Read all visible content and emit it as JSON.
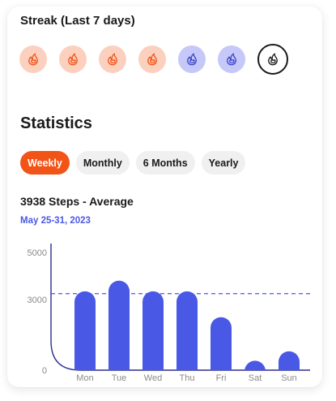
{
  "streak": {
    "title": "Streak (Last 7 days)",
    "days": [
      {
        "state": "done",
        "color": "#f25418",
        "icon": "fire-icon"
      },
      {
        "state": "done",
        "color": "#f25418",
        "icon": "fire-icon"
      },
      {
        "state": "done",
        "color": "#f25418",
        "icon": "fire-icon"
      },
      {
        "state": "done",
        "color": "#f25418",
        "icon": "fire-icon"
      },
      {
        "state": "partial",
        "color": "#3b46c9",
        "icon": "fire-icon"
      },
      {
        "state": "partial",
        "color": "#3b46c9",
        "icon": "fire-icon"
      },
      {
        "state": "today",
        "color": "#1a1a1a",
        "icon": "fire-icon"
      }
    ]
  },
  "statistics": {
    "title": "Statistics",
    "tabs": [
      "Weekly",
      "Monthly",
      "6 Months",
      "Yearly"
    ],
    "active_tab": "Weekly"
  },
  "summary": {
    "headline": "3938 Steps - Average",
    "date_range": "May 25-31, 2023"
  },
  "colors": {
    "accent": "#f25418",
    "bar": "#4a58e6",
    "average_line": "#4a58e6"
  },
  "chart_data": {
    "type": "bar",
    "categories": [
      "Mon",
      "Tue",
      "Wed",
      "Thu",
      "Fri",
      "Sat",
      "Sun"
    ],
    "values": [
      3350,
      3800,
      3350,
      3350,
      2250,
      400,
      800
    ],
    "ylim": [
      0,
      5000
    ],
    "yticks": [
      0,
      3000,
      5000
    ],
    "average": 3250,
    "grid": false
  }
}
